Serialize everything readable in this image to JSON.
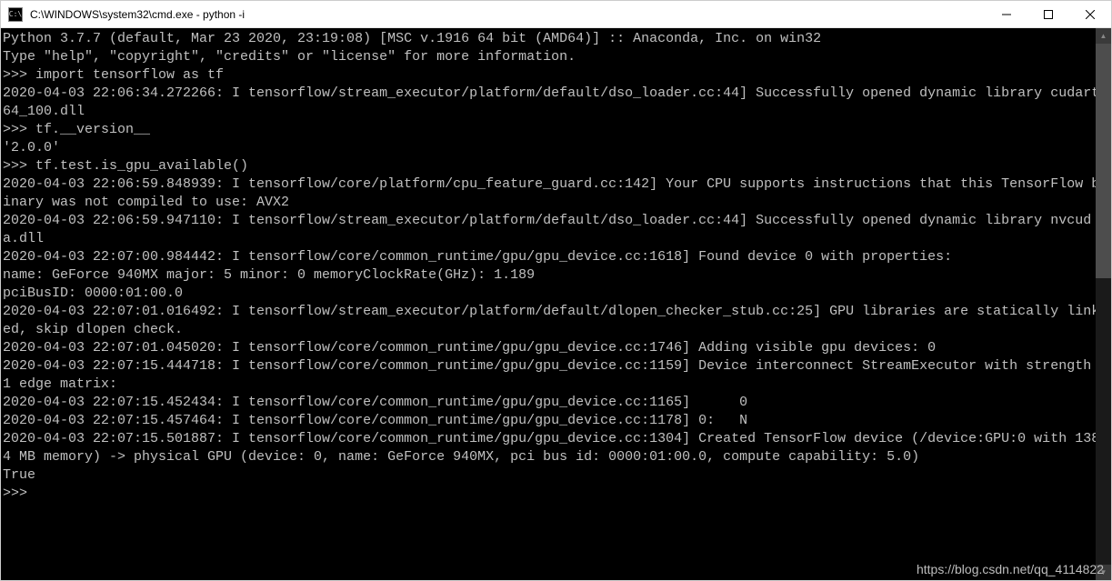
{
  "titlebar": {
    "icon_label": "C:\\",
    "title": "C:\\WINDOWS\\system32\\cmd.exe - python  -i"
  },
  "console": {
    "lines": [
      "Python 3.7.7 (default, Mar 23 2020, 23:19:08) [MSC v.1916 64 bit (AMD64)] :: Anaconda, Inc. on win32",
      "Type \"help\", \"copyright\", \"credits\" or \"license\" for more information.",
      ">>> import tensorflow as tf",
      "2020-04-03 22:06:34.272266: I tensorflow/stream_executor/platform/default/dso_loader.cc:44] Successfully opened dynamic library cudart64_100.dll",
      ">>> tf.__version__",
      "'2.0.0'",
      ">>> tf.test.is_gpu_available()",
      "2020-04-03 22:06:59.848939: I tensorflow/core/platform/cpu_feature_guard.cc:142] Your CPU supports instructions that this TensorFlow binary was not compiled to use: AVX2",
      "2020-04-03 22:06:59.947110: I tensorflow/stream_executor/platform/default/dso_loader.cc:44] Successfully opened dynamic library nvcuda.dll",
      "2020-04-03 22:07:00.984442: I tensorflow/core/common_runtime/gpu/gpu_device.cc:1618] Found device 0 with properties:",
      "name: GeForce 940MX major: 5 minor: 0 memoryClockRate(GHz): 1.189",
      "pciBusID: 0000:01:00.0",
      "2020-04-03 22:07:01.016492: I tensorflow/stream_executor/platform/default/dlopen_checker_stub.cc:25] GPU libraries are statically linked, skip dlopen check.",
      "2020-04-03 22:07:01.045020: I tensorflow/core/common_runtime/gpu/gpu_device.cc:1746] Adding visible gpu devices: 0",
      "2020-04-03 22:07:15.444718: I tensorflow/core/common_runtime/gpu/gpu_device.cc:1159] Device interconnect StreamExecutor with strength 1 edge matrix:",
      "2020-04-03 22:07:15.452434: I tensorflow/core/common_runtime/gpu/gpu_device.cc:1165]      0",
      "2020-04-03 22:07:15.457464: I tensorflow/core/common_runtime/gpu/gpu_device.cc:1178] 0:   N",
      "2020-04-03 22:07:15.501887: I tensorflow/core/common_runtime/gpu/gpu_device.cc:1304] Created TensorFlow device (/device:GPU:0 with 1384 MB memory) -> physical GPU (device: 0, name: GeForce 940MX, pci bus id: 0000:01:00.0, compute capability: 5.0)",
      "True",
      ">>>"
    ]
  },
  "watermark": "https://blog.csdn.net/qq_4114822"
}
